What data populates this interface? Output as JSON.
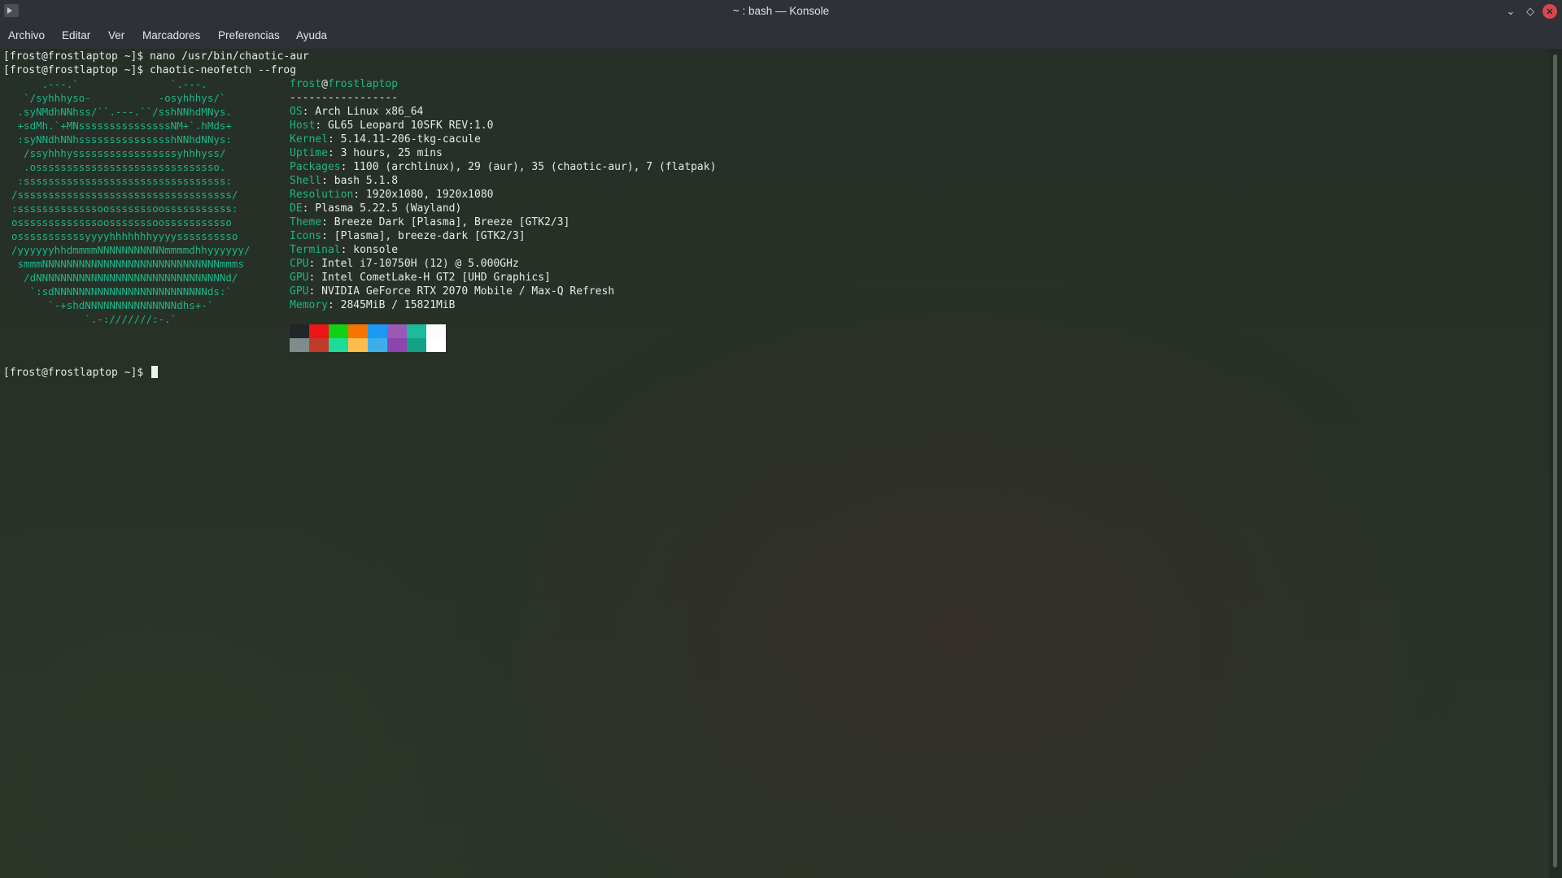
{
  "window": {
    "title": "~ : bash — Konsole"
  },
  "menubar": {
    "items": [
      "Archivo",
      "Editar",
      "Ver",
      "Marcadores",
      "Preferencias",
      "Ayuda"
    ]
  },
  "terminal": {
    "command_lines": [
      "[frost@frostlaptop ~]$ nano /usr/bin/chaotic-aur",
      "[frost@frostlaptop ~]$ chaotic-neofetch --frog"
    ],
    "logo_lines": [
      "     .---.`               `.---.",
      "  `/syhhhyso-           -osyhhhys/`",
      " .syNMdhNNhss/``.---.``/sshNNhdMNys.",
      " +sdMh.`+MNsssssssssssssssNM+`.hMds+",
      " :syNNdhNNhssssssssssssssshNNhdNNys:",
      "  /ssyhhhysssssssssssssssssyhhhyss/",
      "  .ossssssssssssssssssssssssssssso.",
      " :sssssssssssssssssssssssssssssssss:",
      "/sssssssssssssssssssssssssssssssssss/",
      ":sssssssssssssoosssssssoosssssssssss:",
      "osssssssssssssoosssssssoosssssssssso",
      "osssssssssssyyyyhhhhhhhyyyyssssssssso",
      "/yyyyyyhhdmmmmNNNNNNNNNNNmmmmdhhyyyyyy/",
      " smmmNNNNNNNNNNNNNNNNNNNNNNNNNNNNNmmms",
      "  /dNNNNNNNNNNNNNNNNNNNNNNNNNNNNNNNd/",
      "   `:sdNNNNNNNNNNNNNNNNNNNNNNNNNds:`",
      "      `-+shdNNNNNNNNNNNNNNNdhs+-`",
      "            `.-:///////:-.`"
    ],
    "user_host": {
      "user": "frost",
      "at": "@",
      "host": "frostlaptop"
    },
    "separator": "-----------------",
    "info": [
      {
        "key": "OS",
        "value": ": Arch Linux x86_64"
      },
      {
        "key": "Host",
        "value": ": GL65 Leopard 10SFK REV:1.0"
      },
      {
        "key": "Kernel",
        "value": ": 5.14.11-206-tkg-cacule"
      },
      {
        "key": "Uptime",
        "value": ": 3 hours, 25 mins"
      },
      {
        "key": "Packages",
        "value": ": 1100 (archlinux), 29 (aur), 35 (chaotic-aur), 7 (flatpak)"
      },
      {
        "key": "Shell",
        "value": ": bash 5.1.8"
      },
      {
        "key": "Resolution",
        "value": ": 1920x1080, 1920x1080"
      },
      {
        "key": "DE",
        "value": ": Plasma 5.22.5 (Wayland)"
      },
      {
        "key": "Theme",
        "value": ": Breeze Dark [Plasma], Breeze [GTK2/3]"
      },
      {
        "key": "Icons",
        "value": ": [Plasma], breeze-dark [GTK2/3]"
      },
      {
        "key": "Terminal",
        "value": ": konsole"
      },
      {
        "key": "CPU",
        "value": ": Intel i7-10750H (12) @ 5.000GHz"
      },
      {
        "key": "GPU",
        "value": ": Intel CometLake-H GT2 [UHD Graphics]"
      },
      {
        "key": "GPU",
        "value": ": NVIDIA GeForce RTX 2070 Mobile / Max-Q Refresh"
      },
      {
        "key": "Memory",
        "value": ": 2845MiB / 15821MiB"
      }
    ],
    "palette_top": [
      "#232627",
      "#ed1515",
      "#11d116",
      "#f67400",
      "#1d99f3",
      "#9b59b6",
      "#1abc9c",
      "#fcfcfc"
    ],
    "palette_bottom": [
      "#7f8c8d",
      "#c0392b",
      "#1cdc9a",
      "#fdbc4b",
      "#3daee9",
      "#8e44ad",
      "#16a085",
      "#ffffff"
    ],
    "prompt": "[frost@frostlaptop ~]$ "
  },
  "colors": {
    "accent": "#1fb48a",
    "close_button": "#d9474f"
  }
}
